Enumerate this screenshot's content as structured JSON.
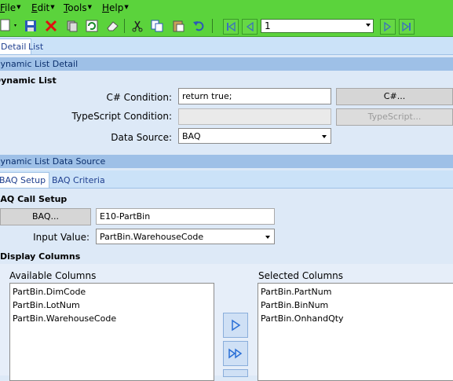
{
  "menu": [
    {
      "label": "File",
      "accel": "F",
      "rest": "ile"
    },
    {
      "label": "Edit",
      "accel": "E",
      "rest": "dit"
    },
    {
      "label": "Tools",
      "accel": "T",
      "rest": "ools"
    },
    {
      "label": "Help",
      "accel": "H",
      "rest": "elp"
    }
  ],
  "toolbar": {
    "icons": [
      "new-icon",
      "save-icon",
      "delete-icon",
      "clear-icon",
      "refresh-icon",
      "eraser-icon",
      "cut-icon",
      "copy-icon",
      "paste-icon",
      "undo-icon",
      "first-record-icon",
      "previous-record-icon",
      "next-record-icon",
      "last-record-icon"
    ],
    "record_value": "1"
  },
  "tabs": {
    "detail": "Detail",
    "list": "List"
  },
  "section_detail": "Dynamic List Detail",
  "group_dynamic_list": "Dynamic List",
  "cs_condition": {
    "label": "C# Condition:",
    "value": "return true;",
    "button": "C#..."
  },
  "ts_condition": {
    "label": "TypeScript Condition:",
    "value": "",
    "button": "TypeScript..."
  },
  "data_source": {
    "label": "Data Source:",
    "value": "BAQ"
  },
  "section_data_source": "Dynamic List Data Source",
  "sub_tabs": {
    "baq_setup": "BAQ Setup",
    "baq_criteria": "BAQ Criteria"
  },
  "group_baq_call": "BAQ Call Setup",
  "baq": {
    "button": "BAQ...",
    "value": "E10-PartBin"
  },
  "input_value": {
    "label": "Input Value:",
    "value": "PartBin.WarehouseCode"
  },
  "group_display_columns": "Display Columns",
  "available": {
    "label": "Available Columns",
    "items": [
      "PartBin.DimCode",
      "PartBin.LotNum",
      "PartBin.WarehouseCode"
    ]
  },
  "selected": {
    "label": "Selected Columns",
    "items": [
      "PartBin.PartNum",
      "PartBin.BinNum",
      "PartBin.OnhandQty"
    ]
  },
  "colors": {
    "toolbar": "#5bd33c",
    "header": "#9ec0e7",
    "panel": "#dde9f7",
    "accent": "#2a6fd6"
  }
}
